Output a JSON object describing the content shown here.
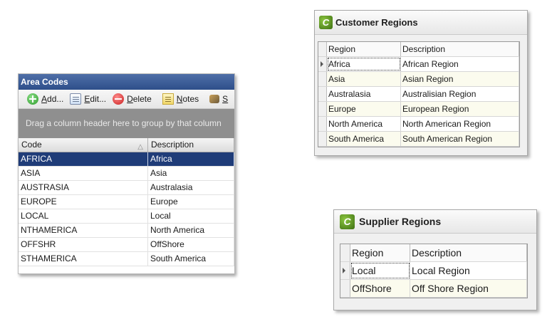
{
  "area_codes": {
    "title": "Area Codes",
    "toolbar": {
      "add": {
        "hot": "A",
        "rest": "dd..."
      },
      "edit": {
        "hot": "E",
        "rest": "dit..."
      },
      "delete": {
        "hot": "D",
        "rest": "elete"
      },
      "notes": {
        "hot": "N",
        "rest": "otes"
      },
      "more": {
        "hot": "S",
        "rest": ""
      }
    },
    "group_panel_text": "Drag a column header here to group by that column",
    "columns": [
      "Code",
      "Description"
    ],
    "rows": [
      {
        "code": "AFRICA",
        "description": "Africa"
      },
      {
        "code": "ASIA",
        "description": "Asia"
      },
      {
        "code": "AUSTRASIA",
        "description": "Australasia"
      },
      {
        "code": "EUROPE",
        "description": "Europe"
      },
      {
        "code": "LOCAL",
        "description": "Local"
      },
      {
        "code": "NTHAMERICA",
        "description": "North America"
      },
      {
        "code": "OFFSHR",
        "description": "OffShore"
      },
      {
        "code": "STHAMERICA",
        "description": "South America"
      }
    ],
    "selected_row": 0
  },
  "customer_regions": {
    "title": "Customer Regions",
    "columns": [
      "Region",
      "Description"
    ],
    "rows": [
      {
        "region": "Africa",
        "description": "African Region"
      },
      {
        "region": "Asia",
        "description": "Asian Region"
      },
      {
        "region": "Australasia",
        "description": "Australisian Region"
      },
      {
        "region": "Europe",
        "description": "European Region"
      },
      {
        "region": "North America",
        "description": "North American Region"
      },
      {
        "region": "South America",
        "description": "South American Region"
      }
    ]
  },
  "supplier_regions": {
    "title": "Supplier Regions",
    "columns": [
      "Region",
      "Description"
    ],
    "rows": [
      {
        "region": "Local",
        "description": "Local Region"
      },
      {
        "region": "OffShore",
        "description": "Off Shore Region"
      }
    ]
  },
  "colors": {
    "title_bar": "#2e4f8a",
    "selected_row": "#1f3c78",
    "group_panel": "#8f8f8f",
    "logo_green": "#5a9a22"
  },
  "icons": [
    "add-icon",
    "edit-icon",
    "delete-icon",
    "notes-icon",
    "more-icon",
    "app-logo-icon",
    "sort-ascending-icon",
    "current-row-indicator-icon"
  ]
}
